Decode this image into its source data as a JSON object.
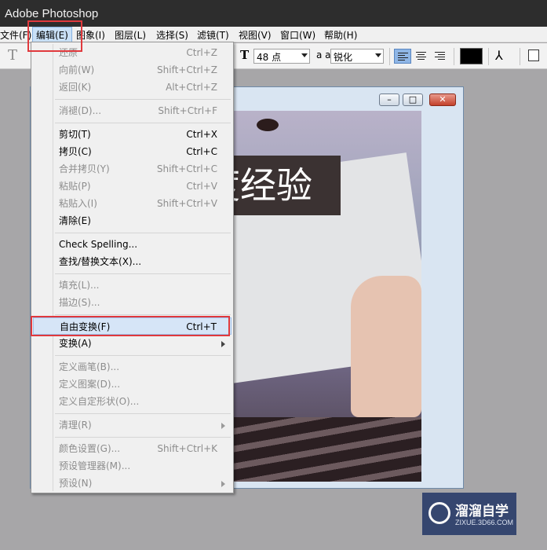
{
  "app": {
    "title": "Adobe Photoshop"
  },
  "menubar": [
    {
      "label": "文件(F)"
    },
    {
      "label": "编辑(E)",
      "active": true
    },
    {
      "label": "图象(I)"
    },
    {
      "label": "图层(L)"
    },
    {
      "label": "选择(S)"
    },
    {
      "label": "滤镜(T)"
    },
    {
      "label": "视图(V)"
    },
    {
      "label": "窗口(W)"
    },
    {
      "label": "帮助(H)"
    }
  ],
  "options": {
    "tool_icon": "T",
    "size_icon_glyph": "T",
    "font_size": "48 点",
    "aa_icon_glyph": "a a",
    "antialias": "锐化",
    "alignment": [
      "left",
      "center",
      "right"
    ],
    "active_alignment": "left",
    "text_color": "#000000",
    "icons": [
      "text-tool-icon",
      "font-size-icon",
      "antialias-icon",
      "align-left-icon",
      "align-center-icon",
      "align-right-icon",
      "warp-text-icon",
      "palettes-icon"
    ]
  },
  "document": {
    "text_layer": "度经验",
    "window_buttons": [
      "minimize",
      "maximize",
      "close"
    ]
  },
  "edit_menu": {
    "items": [
      {
        "label": "还原",
        "shortcut": "Ctrl+Z",
        "disabled": true
      },
      {
        "label": "向前(W)",
        "shortcut": "Shift+Ctrl+Z",
        "disabled": true
      },
      {
        "label": "返回(K)",
        "shortcut": "Alt+Ctrl+Z",
        "disabled": true
      },
      {
        "label": "消褪(D)...",
        "shortcut": "Shift+Ctrl+F",
        "disabled": true
      },
      {
        "label": "剪切(T)",
        "shortcut": "Ctrl+X",
        "disabled": false
      },
      {
        "label": "拷贝(C)",
        "shortcut": "Ctrl+C",
        "disabled": false
      },
      {
        "label": "合并拷贝(Y)",
        "shortcut": "Shift+Ctrl+C",
        "disabled": true
      },
      {
        "label": "粘贴(P)",
        "shortcut": "Ctrl+V",
        "disabled": true
      },
      {
        "label": "粘贴入(I)",
        "shortcut": "Shift+Ctrl+V",
        "disabled": true
      },
      {
        "label": "清除(E)",
        "shortcut": "",
        "disabled": false
      },
      {
        "label": "Check Spelling...",
        "shortcut": "",
        "disabled": false
      },
      {
        "label": "查找/替换文本(X)...",
        "shortcut": "",
        "disabled": false
      },
      {
        "label": "填充(L)...",
        "shortcut": "",
        "disabled": true
      },
      {
        "label": "描边(S)...",
        "shortcut": "",
        "disabled": true
      },
      {
        "label": "自由变换(F)",
        "shortcut": "Ctrl+T",
        "disabled": false,
        "highlighted": true
      },
      {
        "label": "变换(A)",
        "shortcut": "",
        "disabled": false,
        "submenu": true
      },
      {
        "label": "定义画笔(B)...",
        "shortcut": "",
        "disabled": true
      },
      {
        "label": "定义图案(D)...",
        "shortcut": "",
        "disabled": true
      },
      {
        "label": "定义自定形状(O)...",
        "shortcut": "",
        "disabled": true
      },
      {
        "label": "清理(R)",
        "shortcut": "",
        "disabled": true,
        "submenu": true
      },
      {
        "label": "颜色设置(G)...",
        "shortcut": "Shift+Ctrl+K",
        "disabled": true
      },
      {
        "label": "预设管理器(M)...",
        "shortcut": "",
        "disabled": true
      },
      {
        "label": "预设(N)",
        "shortcut": "",
        "disabled": true,
        "submenu": true
      }
    ]
  },
  "watermark": {
    "title": "溜溜自学",
    "subtitle": "ZIXUE.3D66.COM"
  },
  "colors": {
    "annotation": "#e0393d",
    "titlebar": "#2d2d2d",
    "workspace": "#a7a6a8"
  }
}
